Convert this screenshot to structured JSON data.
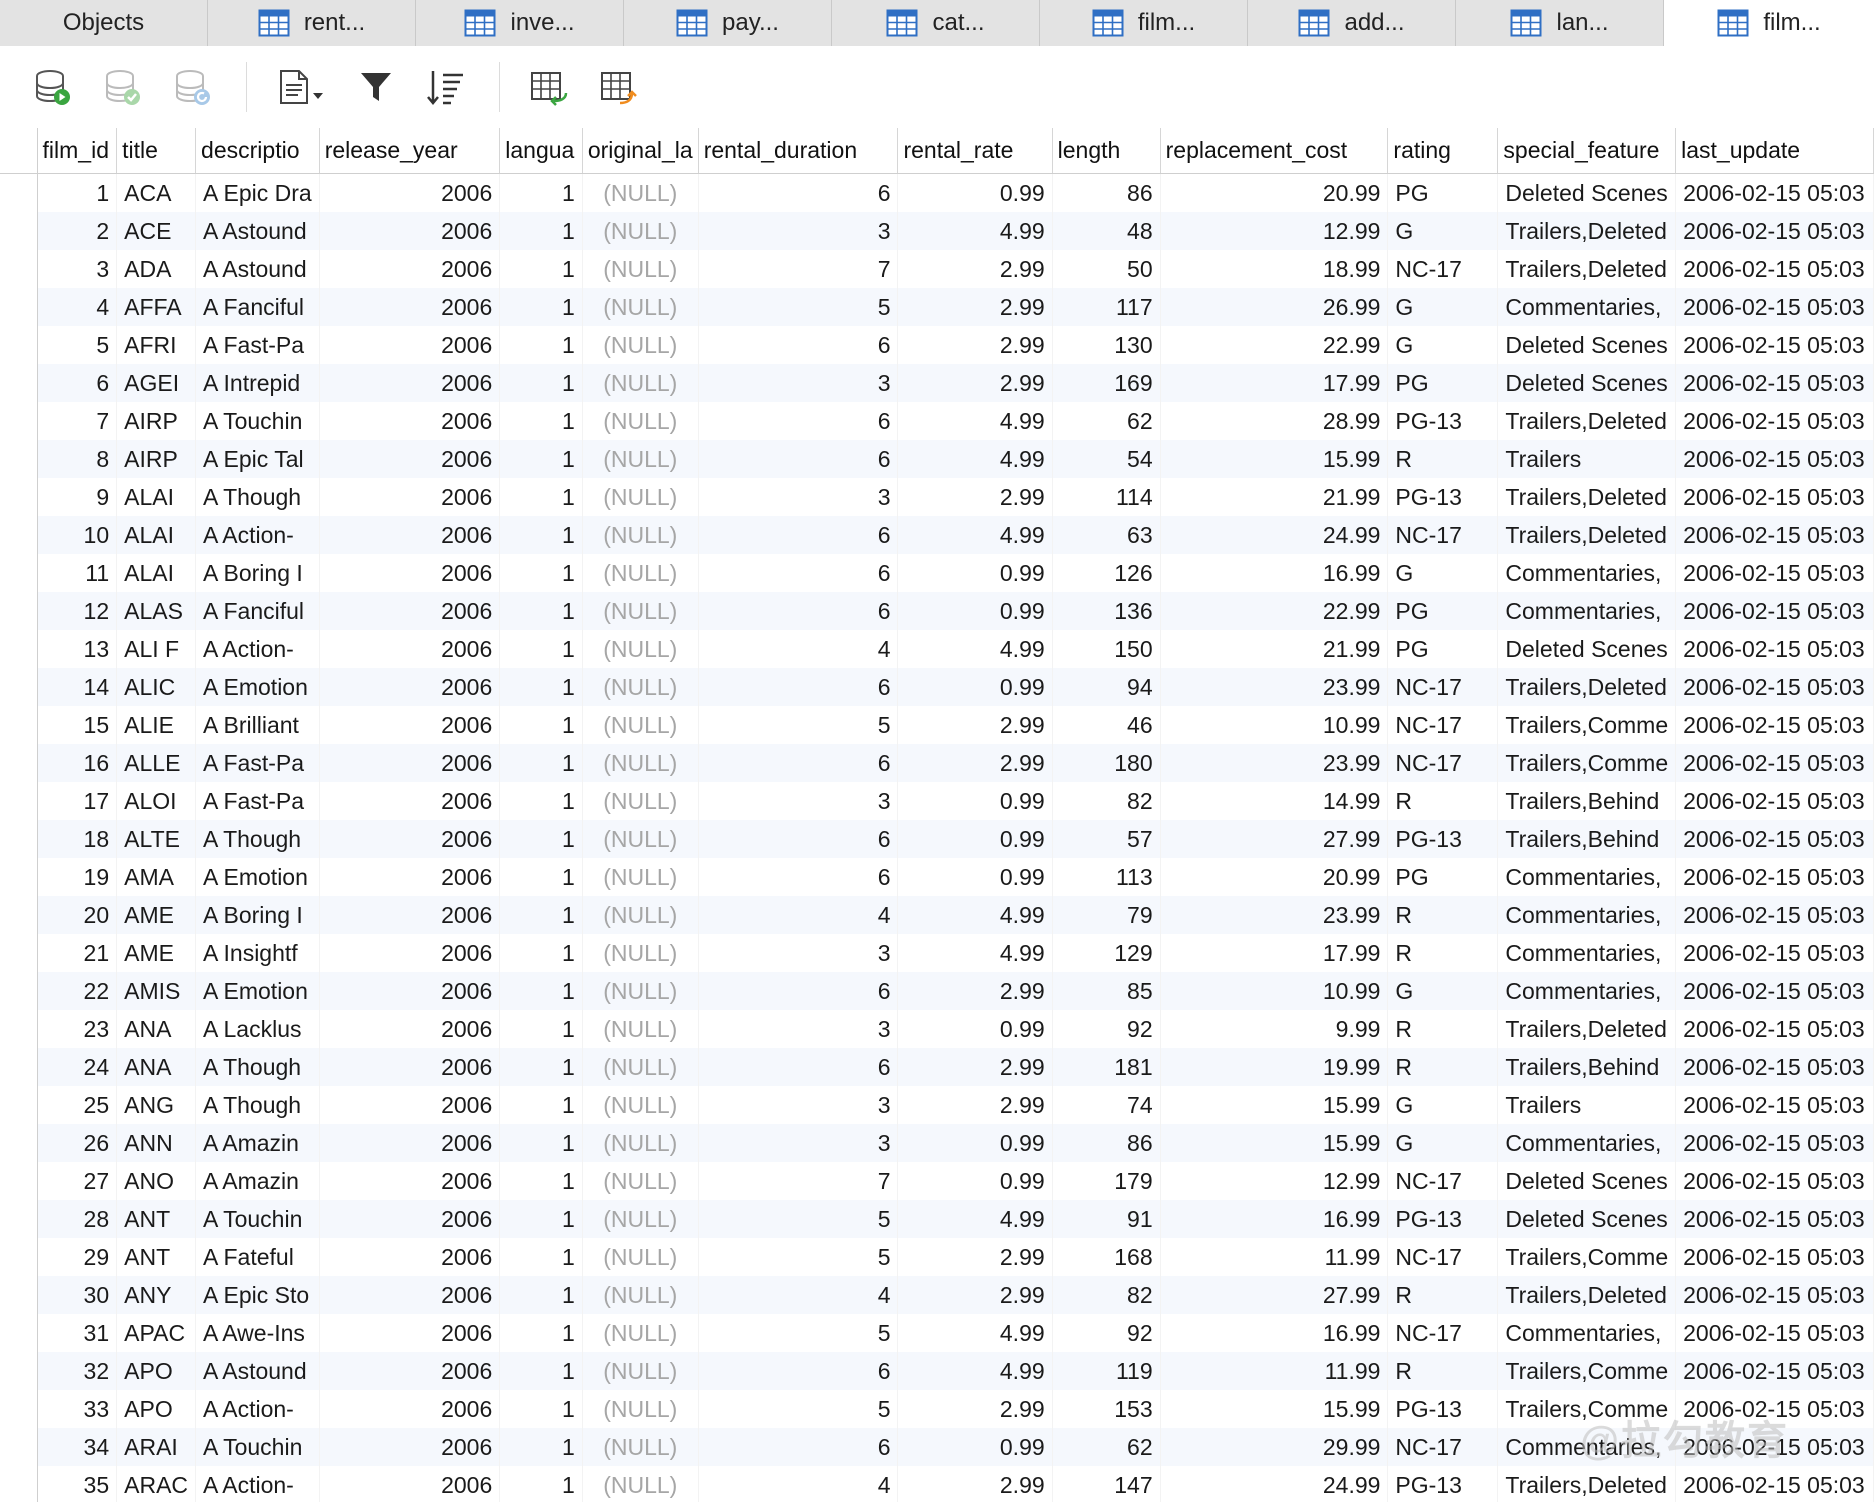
{
  "tabs": [
    {
      "label": "Objects",
      "icon": "none"
    },
    {
      "label": "rent...",
      "icon": "table-icon"
    },
    {
      "label": "inve...",
      "icon": "table-icon"
    },
    {
      "label": "pay...",
      "icon": "table-icon"
    },
    {
      "label": "cat...",
      "icon": "table-icon"
    },
    {
      "label": "film...",
      "icon": "table-icon"
    },
    {
      "label": "add...",
      "icon": "table-icon"
    },
    {
      "label": "lan...",
      "icon": "table-icon"
    },
    {
      "label": "film...",
      "icon": "table-icon",
      "active": true
    }
  ],
  "toolbar": {
    "buttons": [
      "begin-transaction-icon",
      "commit-icon",
      "rollback-icon",
      "text-view-icon",
      "filter-icon",
      "sort-icon",
      "import-icon",
      "export-icon"
    ]
  },
  "grid": {
    "columns": [
      "film_id",
      "title",
      "descriptio",
      "release_year",
      "langua",
      "original_la",
      "rental_duration",
      "rental_rate",
      "length",
      "replacement_cost",
      "rating",
      "special_feature",
      "last_update"
    ],
    "rows": [
      [
        "1",
        "ACA",
        "A Epic Dra",
        "2006",
        "1",
        "(NULL)",
        "6",
        "0.99",
        "86",
        "20.99",
        "PG",
        "Deleted Scenes",
        "2006-02-15 05:03"
      ],
      [
        "2",
        "ACE",
        "A Astound",
        "2006",
        "1",
        "(NULL)",
        "3",
        "4.99",
        "48",
        "12.99",
        "G",
        "Trailers,Deleted",
        "2006-02-15 05:03"
      ],
      [
        "3",
        "ADA",
        "A Astound",
        "2006",
        "1",
        "(NULL)",
        "7",
        "2.99",
        "50",
        "18.99",
        "NC-17",
        "Trailers,Deleted",
        "2006-02-15 05:03"
      ],
      [
        "4",
        "AFFA",
        "A Fanciful",
        "2006",
        "1",
        "(NULL)",
        "5",
        "2.99",
        "117",
        "26.99",
        "G",
        "Commentaries,",
        "2006-02-15 05:03"
      ],
      [
        "5",
        "AFRI",
        "A Fast-Pa",
        "2006",
        "1",
        "(NULL)",
        "6",
        "2.99",
        "130",
        "22.99",
        "G",
        "Deleted Scenes",
        "2006-02-15 05:03"
      ],
      [
        "6",
        "AGEI",
        "A Intrepid",
        "2006",
        "1",
        "(NULL)",
        "3",
        "2.99",
        "169",
        "17.99",
        "PG",
        "Deleted Scenes",
        "2006-02-15 05:03"
      ],
      [
        "7",
        "AIRP",
        "A Touchin",
        "2006",
        "1",
        "(NULL)",
        "6",
        "4.99",
        "62",
        "28.99",
        "PG-13",
        "Trailers,Deleted",
        "2006-02-15 05:03"
      ],
      [
        "8",
        "AIRP",
        "A Epic Tal",
        "2006",
        "1",
        "(NULL)",
        "6",
        "4.99",
        "54",
        "15.99",
        "R",
        "Trailers",
        "2006-02-15 05:03"
      ],
      [
        "9",
        "ALAI",
        "A Though",
        "2006",
        "1",
        "(NULL)",
        "3",
        "2.99",
        "114",
        "21.99",
        "PG-13",
        "Trailers,Deleted",
        "2006-02-15 05:03"
      ],
      [
        "10",
        "ALAI",
        "A Action-",
        "2006",
        "1",
        "(NULL)",
        "6",
        "4.99",
        "63",
        "24.99",
        "NC-17",
        "Trailers,Deleted",
        "2006-02-15 05:03"
      ],
      [
        "11",
        "ALAI",
        "A Boring I",
        "2006",
        "1",
        "(NULL)",
        "6",
        "0.99",
        "126",
        "16.99",
        "G",
        "Commentaries,",
        "2006-02-15 05:03"
      ],
      [
        "12",
        "ALAS",
        "A Fanciful",
        "2006",
        "1",
        "(NULL)",
        "6",
        "0.99",
        "136",
        "22.99",
        "PG",
        "Commentaries,",
        "2006-02-15 05:03"
      ],
      [
        "13",
        "ALI F",
        "A Action-",
        "2006",
        "1",
        "(NULL)",
        "4",
        "4.99",
        "150",
        "21.99",
        "PG",
        "Deleted Scenes",
        "2006-02-15 05:03"
      ],
      [
        "14",
        "ALIC",
        "A Emotion",
        "2006",
        "1",
        "(NULL)",
        "6",
        "0.99",
        "94",
        "23.99",
        "NC-17",
        "Trailers,Deleted",
        "2006-02-15 05:03"
      ],
      [
        "15",
        "ALIE",
        "A Brilliant",
        "2006",
        "1",
        "(NULL)",
        "5",
        "2.99",
        "46",
        "10.99",
        "NC-17",
        "Trailers,Comme",
        "2006-02-15 05:03"
      ],
      [
        "16",
        "ALLE",
        "A Fast-Pa",
        "2006",
        "1",
        "(NULL)",
        "6",
        "2.99",
        "180",
        "23.99",
        "NC-17",
        "Trailers,Comme",
        "2006-02-15 05:03"
      ],
      [
        "17",
        "ALOI",
        "A Fast-Pa",
        "2006",
        "1",
        "(NULL)",
        "3",
        "0.99",
        "82",
        "14.99",
        "R",
        "Trailers,Behind",
        "2006-02-15 05:03"
      ],
      [
        "18",
        "ALTE",
        "A Though",
        "2006",
        "1",
        "(NULL)",
        "6",
        "0.99",
        "57",
        "27.99",
        "PG-13",
        "Trailers,Behind",
        "2006-02-15 05:03"
      ],
      [
        "19",
        "AMA",
        "A Emotion",
        "2006",
        "1",
        "(NULL)",
        "6",
        "0.99",
        "113",
        "20.99",
        "PG",
        "Commentaries,",
        "2006-02-15 05:03"
      ],
      [
        "20",
        "AME",
        "A Boring I",
        "2006",
        "1",
        "(NULL)",
        "4",
        "4.99",
        "79",
        "23.99",
        "R",
        "Commentaries,",
        "2006-02-15 05:03"
      ],
      [
        "21",
        "AME",
        "A Insightf",
        "2006",
        "1",
        "(NULL)",
        "3",
        "4.99",
        "129",
        "17.99",
        "R",
        "Commentaries,",
        "2006-02-15 05:03"
      ],
      [
        "22",
        "AMIS",
        "A Emotion",
        "2006",
        "1",
        "(NULL)",
        "6",
        "2.99",
        "85",
        "10.99",
        "G",
        "Commentaries,",
        "2006-02-15 05:03"
      ],
      [
        "23",
        "ANA",
        "A Lacklus",
        "2006",
        "1",
        "(NULL)",
        "3",
        "0.99",
        "92",
        "9.99",
        "R",
        "Trailers,Deleted",
        "2006-02-15 05:03"
      ],
      [
        "24",
        "ANA",
        "A Though",
        "2006",
        "1",
        "(NULL)",
        "6",
        "2.99",
        "181",
        "19.99",
        "R",
        "Trailers,Behind",
        "2006-02-15 05:03"
      ],
      [
        "25",
        "ANG",
        "A Though",
        "2006",
        "1",
        "(NULL)",
        "3",
        "2.99",
        "74",
        "15.99",
        "G",
        "Trailers",
        "2006-02-15 05:03"
      ],
      [
        "26",
        "ANN",
        "A Amazin",
        "2006",
        "1",
        "(NULL)",
        "3",
        "0.99",
        "86",
        "15.99",
        "G",
        "Commentaries,",
        "2006-02-15 05:03"
      ],
      [
        "27",
        "ANO",
        "A Amazin",
        "2006",
        "1",
        "(NULL)",
        "7",
        "0.99",
        "179",
        "12.99",
        "NC-17",
        "Deleted Scenes",
        "2006-02-15 05:03"
      ],
      [
        "28",
        "ANT",
        "A Touchin",
        "2006",
        "1",
        "(NULL)",
        "5",
        "4.99",
        "91",
        "16.99",
        "PG-13",
        "Deleted Scenes",
        "2006-02-15 05:03"
      ],
      [
        "29",
        "ANT",
        "A Fateful",
        "2006",
        "1",
        "(NULL)",
        "5",
        "2.99",
        "168",
        "11.99",
        "NC-17",
        "Trailers,Comme",
        "2006-02-15 05:03"
      ],
      [
        "30",
        "ANY",
        "A Epic Sto",
        "2006",
        "1",
        "(NULL)",
        "4",
        "2.99",
        "82",
        "27.99",
        "R",
        "Trailers,Deleted",
        "2006-02-15 05:03"
      ],
      [
        "31",
        "APAC",
        "A Awe-Ins",
        "2006",
        "1",
        "(NULL)",
        "5",
        "4.99",
        "92",
        "16.99",
        "NC-17",
        "Commentaries,",
        "2006-02-15 05:03"
      ],
      [
        "32",
        "APO",
        "A Astound",
        "2006",
        "1",
        "(NULL)",
        "6",
        "4.99",
        "119",
        "11.99",
        "R",
        "Trailers,Comme",
        "2006-02-15 05:03"
      ],
      [
        "33",
        "APO",
        "A Action-",
        "2006",
        "1",
        "(NULL)",
        "5",
        "2.99",
        "153",
        "15.99",
        "PG-13",
        "Trailers,Comme",
        "2006-02-15 05:03"
      ],
      [
        "34",
        "ARAI",
        "A Touchin",
        "2006",
        "1",
        "(NULL)",
        "6",
        "0.99",
        "62",
        "29.99",
        "NC-17",
        "Commentaries,",
        "2006-02-15 05:03"
      ],
      [
        "35",
        "ARAC",
        "A Action-",
        "2006",
        "1",
        "(NULL)",
        "4",
        "2.99",
        "147",
        "24.99",
        "PG-13",
        "Trailers,Deleted",
        "2006-02-15 05:03"
      ]
    ]
  },
  "watermark": "@拉勾教育"
}
